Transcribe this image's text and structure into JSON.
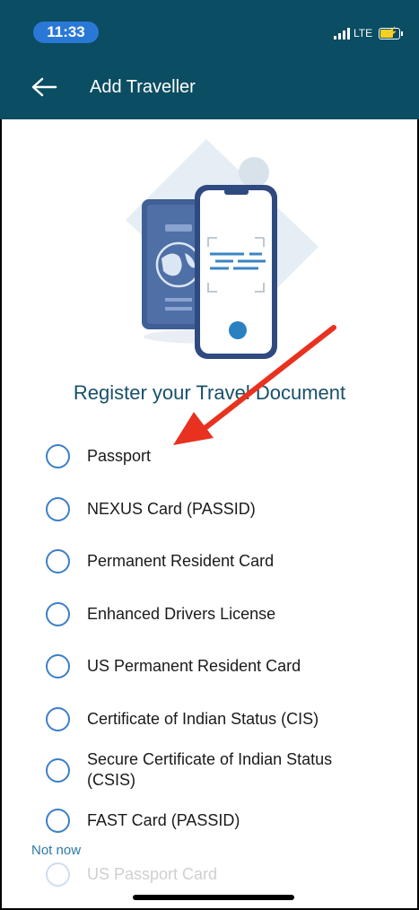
{
  "status_bar": {
    "time": "11:33",
    "network": "LTE"
  },
  "header": {
    "title": "Add Traveller",
    "background": "#0b4d63"
  },
  "main": {
    "heading": "Register your Travel Document",
    "options": [
      {
        "label": "Passport"
      },
      {
        "label": "NEXUS Card (PASSID)"
      },
      {
        "label": "Permanent Resident Card"
      },
      {
        "label": "Enhanced Drivers License"
      },
      {
        "label": "US Permanent Resident Card"
      },
      {
        "label": "Certificate of Indian Status (CIS)"
      },
      {
        "label": "Secure Certificate of Indian Status (CSIS)"
      },
      {
        "label": "FAST Card (PASSID)"
      },
      {
        "label": "US Passport Card"
      }
    ],
    "not_now": "Not now"
  },
  "annotation": {
    "arrow_color": "#e8321f"
  }
}
